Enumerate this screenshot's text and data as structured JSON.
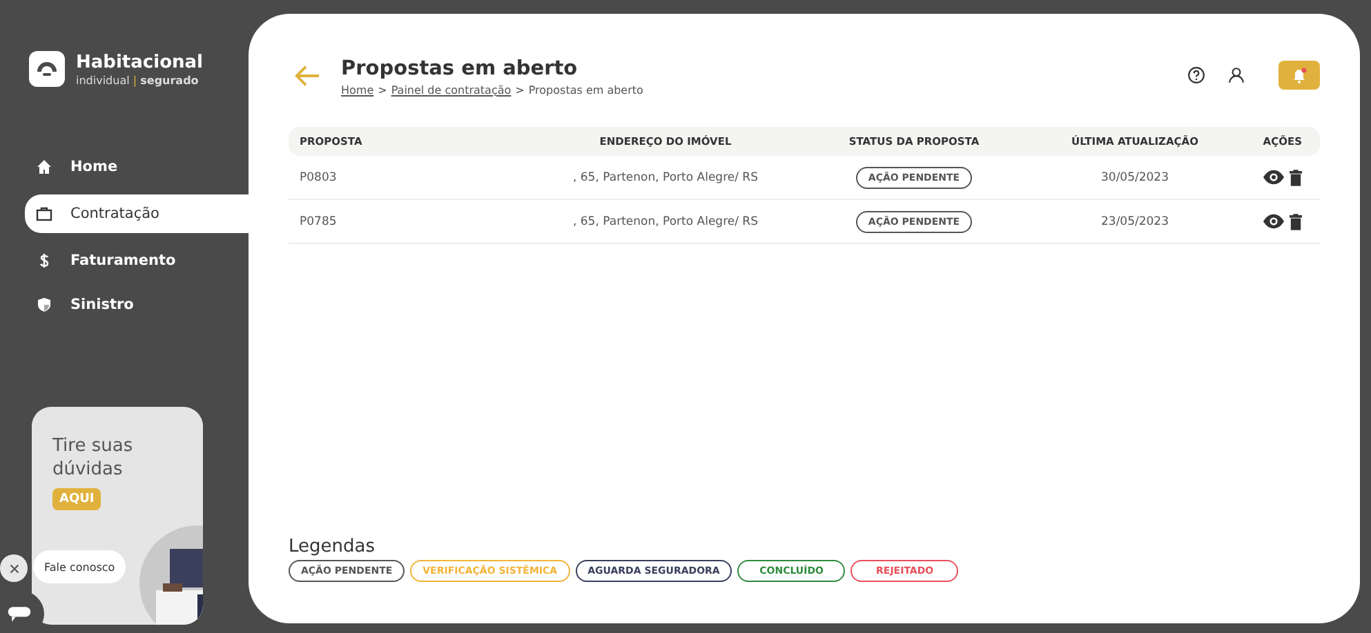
{
  "brand": {
    "name": "Habitacional",
    "sub_left": "individual",
    "sub_sep": "|",
    "sub_right": "segurado"
  },
  "nav": [
    {
      "label": "Home",
      "selected": false
    },
    {
      "label": "Contratação",
      "selected": true
    },
    {
      "label": "Faturamento",
      "selected": false
    },
    {
      "label": "Sinistro",
      "selected": false
    }
  ],
  "promo": {
    "title": "Tire suas dúvidas",
    "button": "AQUI"
  },
  "chat": {
    "label": "Fale conosco"
  },
  "header": {
    "title": "Propostas em aberto",
    "breadcrumb": [
      {
        "label": "Home",
        "link": true
      },
      {
        "label": "Painel de contratação",
        "link": true
      },
      {
        "label": "Propostas em aberto",
        "link": false
      }
    ],
    "separator": ">",
    "notification": true
  },
  "table": {
    "columns": [
      "PROPOSTA",
      "ENDEREÇO DO IMÓVEL",
      "STATUS DA PROPOSTA",
      "ÚLTIMA ATUALIZAÇÃO",
      "AÇÕES"
    ],
    "rows": [
      {
        "proposta": "P0803",
        "endereco": ", 65, Partenon, Porto Alegre/ RS",
        "status": "AÇÃO PENDENTE",
        "data": "30/05/2023"
      },
      {
        "proposta": "P0785",
        "endereco": ", 65, Partenon, Porto Alegre/ RS",
        "status": "AÇÃO PENDENTE",
        "data": "23/05/2023"
      }
    ]
  },
  "legend": {
    "title": "Legendas",
    "items": [
      {
        "label": "AÇÃO PENDENTE",
        "color": "#555555"
      },
      {
        "label": "VERIFICAÇÃO SISTÊMICA",
        "color": "#f2b43a"
      },
      {
        "label": "AGUARDA SEGURADORA",
        "color": "#3a3f5c"
      },
      {
        "label": "CONCLUÍDO",
        "color": "#2e8b3d"
      },
      {
        "label": "REJEITADO",
        "color": "#e8505b"
      }
    ]
  }
}
